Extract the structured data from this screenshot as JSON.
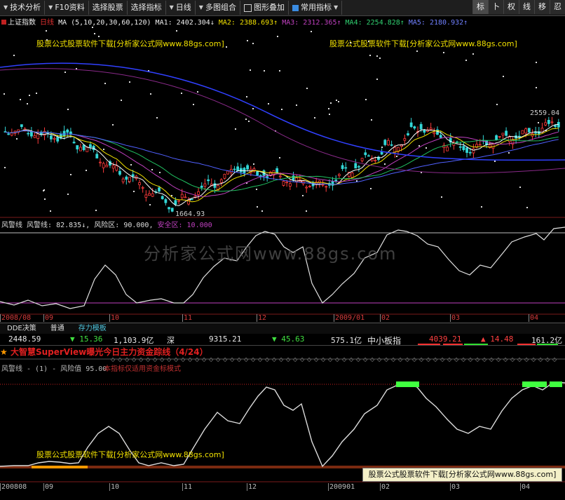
{
  "toolbar": {
    "items": [
      "技术分析",
      "F10资料",
      "选择股票",
      "选择指标",
      "日线",
      "多图组合",
      "图形叠加",
      "常用指标"
    ],
    "right_buttons": [
      "标",
      "卜",
      "权",
      "线",
      "移",
      "忍"
    ]
  },
  "main_chart": {
    "symbol": "上证指数",
    "period": "日线",
    "ma_def": "MA (5,10,20,30,60,120)",
    "ma1": "MA1: 2402.304↓",
    "ma2": "MA2: 2388.693↑",
    "ma3": "MA3: 2312.365↑",
    "ma4": "MA4: 2254.828↑",
    "ma5": "MA5: 2180.932↑",
    "high_label": "2559.04",
    "low_label": "1664.93",
    "watermark": "股票公式股票软件下载[分析家公式网www.88gs.com]"
  },
  "risk_panel": {
    "name": "风警线",
    "line_label": "风警线: 82.835↓,",
    "risk_label": "风险区: 90.000,",
    "safe_label": "安全区: 10.000",
    "big_watermark": "分析家公式网www.88gs.com"
  },
  "date_axis": [
    "2008/08",
    "09",
    "10",
    "11",
    "12",
    "2009/01",
    "02",
    "03",
    "04"
  ],
  "tabs": [
    "DDE决策",
    "普通",
    "存力模板"
  ],
  "quote": {
    "sh_index": "2448.59",
    "sh_change": "▼ 15.36",
    "sh_amount": "1,103.9亿",
    "sz_label": "深",
    "sz_index": "9315.21",
    "sz_change": "▼ 45.63",
    "sz_amount": "575.1亿",
    "sme_label": "中小板指",
    "sme_index": "4039.21",
    "sme_change": "▲ 14.48",
    "last_amount": "161.2亿"
  },
  "banner": {
    "star": "★",
    "text": "大智慧SuperView曝光今日主力资金踪线（4/24）"
  },
  "lower_panel": {
    "legend": "风警线 - (1) - 风险值 95.00",
    "note": "本指标仅适用资金标模式",
    "watermark_left": "股票公式股票软件下载[分析家公式网www.88gs.com]",
    "watermark_corner": "股票公式股票软件下载[分析家公式网www.88gs.com]"
  },
  "date_axis_bottom": [
    "200808",
    "09",
    "10",
    "11",
    "12",
    "200901",
    "02",
    "03",
    "04"
  ],
  "colors": {
    "up": "#ff3b3b",
    "down": "#33d6d6",
    "ma1": "#ffffff",
    "ma2": "#f0e000",
    "ma3": "#c040c0",
    "ma4": "#20c060",
    "ma5": "#5060ff",
    "risk_line": "#e0e0e0",
    "accent_green": "#40ff40",
    "accent_orange": "#ff9900"
  }
}
